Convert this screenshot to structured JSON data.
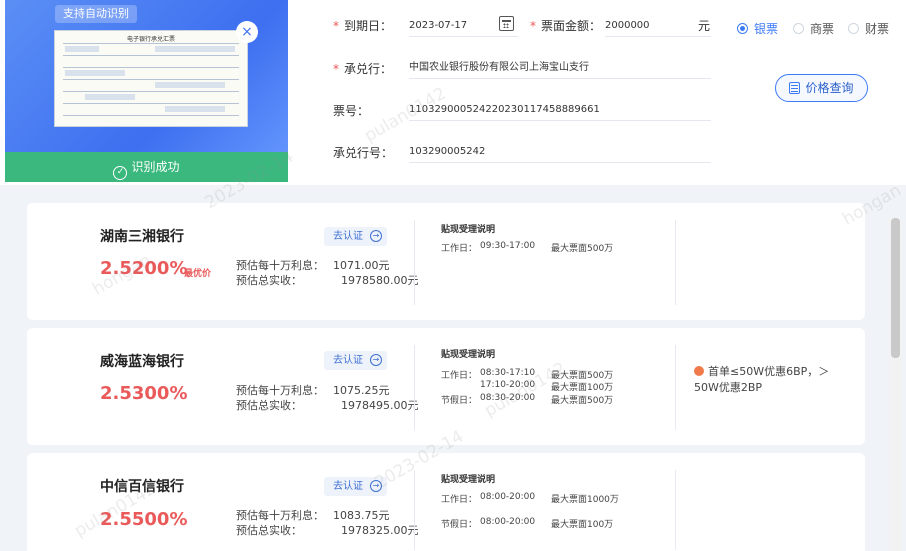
{
  "scan": {
    "auto_tag": "支持自动识别",
    "doc_title": "电子银行承兑汇票",
    "close_symbol": "×",
    "success_label": "识别成功",
    "check_symbol": "✓"
  },
  "form": {
    "due_date_label": "到期日：",
    "due_date_value": "2023-07-17",
    "amount_label": "票面金额：",
    "amount_value": "2000000",
    "amount_unit": "元",
    "acceptor_label": "承兑行：",
    "acceptor_value": "中国农业银行股份有限公司上海宝山支行",
    "ticket_label": "票号：",
    "ticket_value": "110329000524220230117458889661",
    "acceptor_no_label": "承兑行号：",
    "acceptor_no_value": "103290005242",
    "required_mark": "*"
  },
  "ticket_types": [
    {
      "label": "银票",
      "selected": true
    },
    {
      "label": "商票",
      "selected": false
    },
    {
      "label": "财票",
      "selected": false
    }
  ],
  "price_query_label": "价格查询",
  "labels": {
    "certify": "去认证",
    "certify_arrow": "→",
    "interest_label": "预估每十万利息：",
    "total_label": "预估总实收：",
    "rules_title": "贴现受理说明",
    "best_price": "最优价"
  },
  "banks": [
    {
      "name": "湖南三湘银行",
      "rate": "2.5200%",
      "best": true,
      "interest": "1071.00元",
      "total": "1978580.00元",
      "rules": [
        {
          "label": "工作日：",
          "time": "09:30-17:00",
          "limit": "最大票面500万"
        }
      ],
      "promo": ""
    },
    {
      "name": "威海蓝海银行",
      "rate": "2.5300%",
      "best": false,
      "interest": "1075.25元",
      "total": "1978495.00元",
      "rules": [
        {
          "label": "工作日：",
          "time": "08:30-17:10",
          "limit": "最大票面500万"
        },
        {
          "label": "",
          "time": "17:10-20:00",
          "limit": "最大票面100万"
        },
        {
          "label": "节假日：",
          "time": "08:30-20:00",
          "limit": "最大票面500万"
        }
      ],
      "promo_line1": "首单≤50W优惠6BP，＞",
      "promo_line2": "50W优惠2BP"
    },
    {
      "name": "中信百信银行",
      "rate": "2.5500%",
      "best": false,
      "interest": "1083.75元",
      "total": "1978325.00元",
      "rules": [
        {
          "label": "工作日：",
          "time": "08:00-20:00",
          "limit": "最大票面1000万"
        },
        {
          "label": "节假日：",
          "time": "08:00-20:00",
          "limit": "最大票面100万"
        }
      ],
      "promo": ""
    }
  ],
  "watermarks": [
    "pulan0142",
    "2023-02-14",
    "hongan"
  ]
}
